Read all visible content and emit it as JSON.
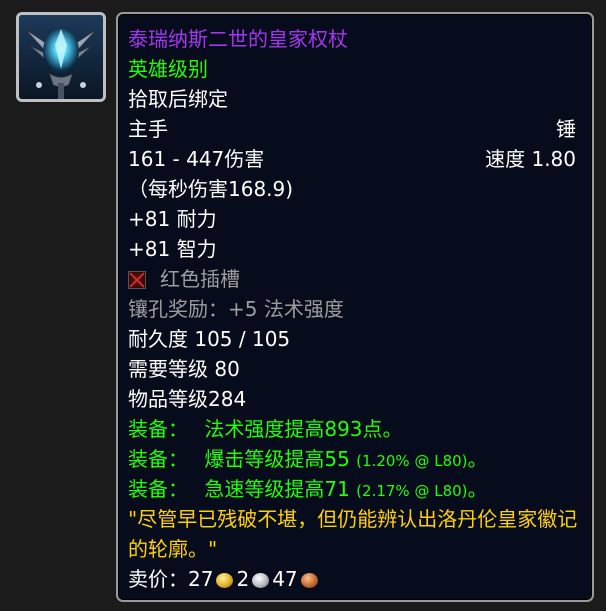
{
  "item": {
    "icon": "mace-icon",
    "name": "泰瑞纳斯二世的皇家权杖",
    "quality": "英雄级别",
    "binding": "拾取后绑定",
    "slot": "主手",
    "type": "锤",
    "damage": "161 - 447伤害",
    "speed": "速度 1.80",
    "dps": "（每秒伤害168.9)",
    "stat_stamina": "+81 耐力",
    "stat_intellect": "+81 智力",
    "socket": "红色插槽",
    "socket_bonus": "镶孔奖励：+5 法术强度",
    "durability": "耐久度 105 / 105",
    "required_level": "需要等级 80",
    "item_level": "物品等级284",
    "equip": [
      {
        "prefix": "装备：",
        "text": "法术强度提高893点。",
        "extra": ""
      },
      {
        "prefix": "装备：",
        "text": "爆击等级提高55",
        "extra": "(1.20% @ L80)",
        "suffix": "。"
      },
      {
        "prefix": "装备：",
        "text": "急速等级提高71",
        "extra": "(2.17% @ L80)",
        "suffix": "。"
      }
    ],
    "flavor": "\"尽管早已残破不堪，但仍能辨认出洛丹伦皇家徽记的轮廓。\"",
    "sell_label": "卖价：",
    "sell_gold": "27",
    "sell_silver": "2",
    "sell_copper": "47"
  },
  "colors": {
    "epic": "#a335ee",
    "uncommon_green": "#1eff00",
    "gray": "#9d9d9d",
    "flavor_gold": "#ffd100"
  }
}
